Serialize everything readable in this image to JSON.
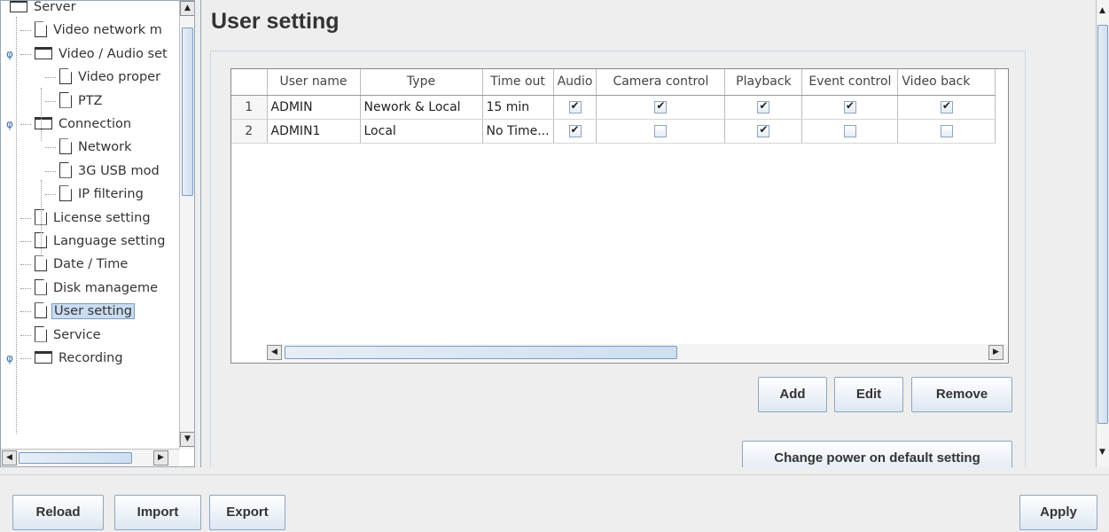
{
  "tree": {
    "items": [
      {
        "label": "Server",
        "icon": "folder-icon",
        "level": 0,
        "expander": ""
      },
      {
        "label": "Video network m",
        "icon": "file-icon",
        "level": 1,
        "expander": ""
      },
      {
        "label": "Video / Audio set",
        "icon": "folder-icon",
        "level": 1,
        "expander": "open"
      },
      {
        "label": "Video proper",
        "icon": "file-icon",
        "level": 2,
        "expander": ""
      },
      {
        "label": "PTZ",
        "icon": "file-icon",
        "level": 2,
        "expander": ""
      },
      {
        "label": "Connection",
        "icon": "folder-icon",
        "level": 1,
        "expander": "open"
      },
      {
        "label": "Network",
        "icon": "file-icon",
        "level": 2,
        "expander": ""
      },
      {
        "label": "3G USB mod",
        "icon": "file-icon",
        "level": 2,
        "expander": ""
      },
      {
        "label": "IP filtering",
        "icon": "file-icon",
        "level": 2,
        "expander": ""
      },
      {
        "label": "License setting",
        "icon": "file-icon",
        "level": 1,
        "expander": ""
      },
      {
        "label": "Language setting",
        "icon": "file-icon",
        "level": 1,
        "expander": ""
      },
      {
        "label": "Date / Time",
        "icon": "file-icon",
        "level": 1,
        "expander": ""
      },
      {
        "label": "Disk manageme",
        "icon": "file-icon",
        "level": 1,
        "expander": ""
      },
      {
        "label": "User setting",
        "icon": "file-icon",
        "level": 1,
        "expander": "",
        "selected": true
      },
      {
        "label": "Service",
        "icon": "file-icon",
        "level": 1,
        "expander": ""
      },
      {
        "label": "Recording",
        "icon": "folder-icon",
        "level": 1,
        "expander": "open"
      }
    ]
  },
  "main": {
    "title": "User setting",
    "table": {
      "columns": [
        "",
        "User name",
        "Type",
        "Time out",
        "Audio",
        "Camera control",
        "Playback",
        "Event control",
        "Video back"
      ],
      "rows": [
        {
          "num": "1",
          "user": "ADMIN",
          "type": "Nework & Local",
          "timeout": "15 min",
          "audio": true,
          "camera": true,
          "playback": true,
          "event": true,
          "videoback": true
        },
        {
          "num": "2",
          "user": "ADMIN1",
          "type": "Local",
          "timeout": "No Time...",
          "audio": true,
          "camera": false,
          "playback": true,
          "event": false,
          "videoback": false
        }
      ]
    },
    "buttons": {
      "add": "Add",
      "edit": "Edit",
      "remove": "Remove",
      "power_default": "Change power on default setting"
    }
  },
  "bottom": {
    "reload": "Reload",
    "import": "Import",
    "export": "Export",
    "apply": "Apply"
  },
  "colors": {
    "accent": "#7a9cc4",
    "selection": "#c9dcf0",
    "button_bottom": "#dde7f2"
  }
}
